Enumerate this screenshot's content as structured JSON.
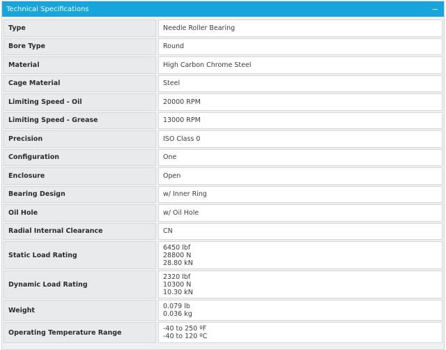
{
  "panel": {
    "title": "Technical Specifications",
    "collapse_glyph": "−",
    "colors": {
      "header": "#16a5dc"
    }
  },
  "specs": [
    {
      "label": "Type",
      "values": [
        "Needle Roller Bearing"
      ]
    },
    {
      "label": "Bore Type",
      "values": [
        "Round"
      ]
    },
    {
      "label": "Material",
      "values": [
        "High Carbon Chrome Steel"
      ]
    },
    {
      "label": "Cage Material",
      "values": [
        "Steel"
      ]
    },
    {
      "label": "Limiting Speed - Oil",
      "values": [
        "20000 RPM"
      ]
    },
    {
      "label": "Limiting Speed - Grease",
      "values": [
        "13000 RPM"
      ]
    },
    {
      "label": "Precision",
      "values": [
        "ISO Class 0"
      ]
    },
    {
      "label": "Configuration",
      "values": [
        "One"
      ]
    },
    {
      "label": "Enclosure",
      "values": [
        "Open"
      ]
    },
    {
      "label": "Bearing Design",
      "values": [
        "w/ Inner Ring"
      ]
    },
    {
      "label": "Oil Hole",
      "values": [
        "w/ Oil Hole"
      ]
    },
    {
      "label": "Radial Internal Clearance",
      "values": [
        "CN"
      ]
    },
    {
      "label": "Static Load Rating",
      "values": [
        "6450 lbf",
        "28800 N",
        "28.80 kN"
      ]
    },
    {
      "label": "Dynamic Load Rating",
      "values": [
        "2320 lbf",
        "10300 N",
        "10.30 kN"
      ]
    },
    {
      "label": "Weight",
      "values": [
        "0.079 lb",
        "0.036 kg"
      ]
    },
    {
      "label": "Operating Temperature Range",
      "values": [
        "-40 to 250 ºF",
        "-40 to 120 ºC"
      ]
    }
  ]
}
